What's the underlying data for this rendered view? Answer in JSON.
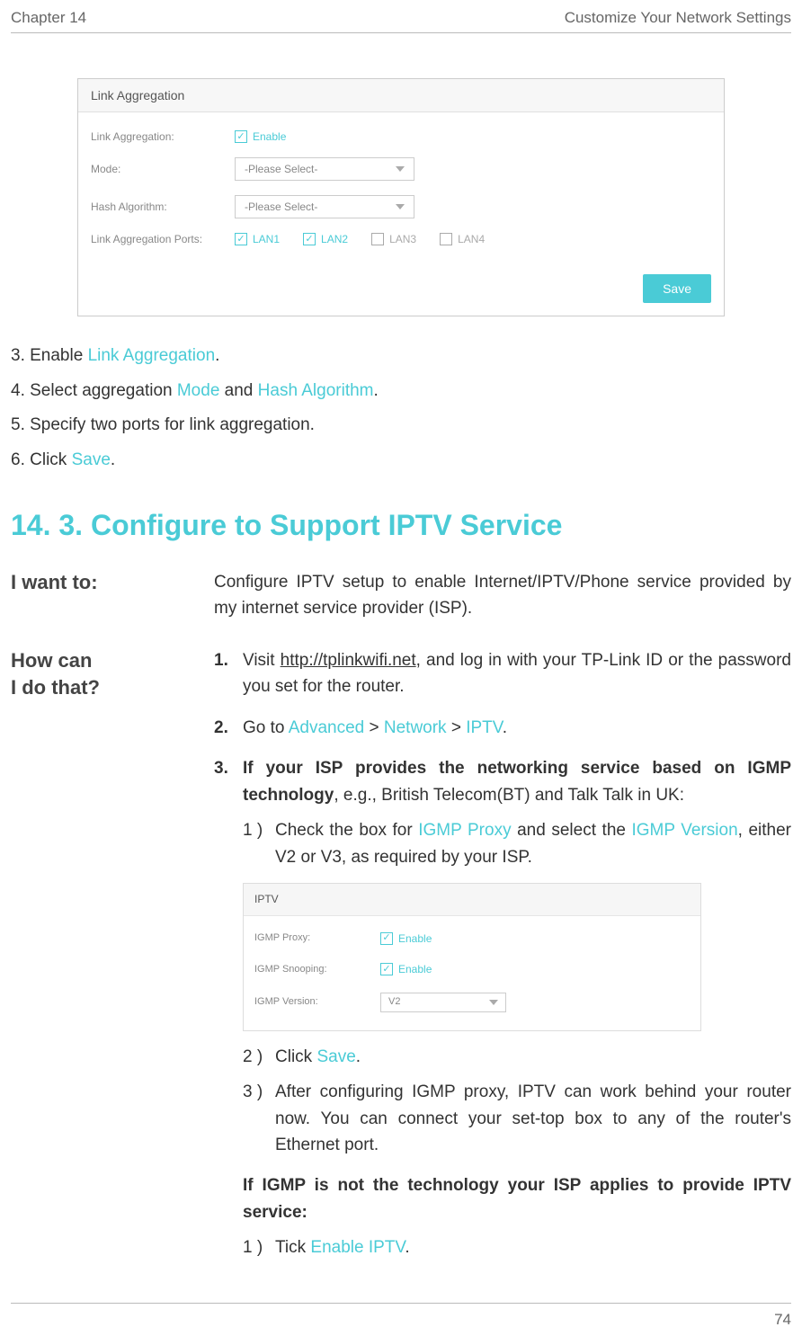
{
  "header": {
    "left": "Chapter 14",
    "right": "Customize Your Network Settings"
  },
  "footer": {
    "page": "74"
  },
  "panel1": {
    "title": "Link Aggregation",
    "rows": {
      "linkAggregationLabel": "Link Aggregation:",
      "enable": "Enable",
      "modeLabel": "Mode:",
      "modeValue": "-Please Select-",
      "hashLabel": "Hash Algorithm:",
      "hashValue": "-Please Select-",
      "portsLabel": "Link Aggregation Ports:",
      "ports": {
        "lan1": "LAN1",
        "lan2": "LAN2",
        "lan3": "LAN3",
        "lan4": "LAN4"
      }
    },
    "save": "Save"
  },
  "steps": {
    "s3a": "3. Enable ",
    "s3b": "Link Aggregation",
    "s3c": ".",
    "s4a": "4. Select aggregation ",
    "s4b": "Mode",
    "s4c": " and ",
    "s4d": "Hash Algorithm",
    "s4e": ".",
    "s5": "5. Specify two ports for link aggregation.",
    "s6a": "6. Click ",
    "s6b": "Save",
    "s6c": "."
  },
  "section": {
    "heading": "14. 3.   Configure to Support IPTV Service"
  },
  "iwant": {
    "label": "I want to:",
    "text": "Configure IPTV setup to enable Internet/IPTV/Phone service provided by my internet service provider (ISP)."
  },
  "howcan": {
    "labelLine1": "How can",
    "labelLine2": "I do that?",
    "li1a": "Visit ",
    "li1url": "http://tplinkwifi.net",
    "li1b": ", and log in with your TP-Link ID or the password you set for the router.",
    "li2a": "Go to ",
    "li2b": "Advanced",
    "li2c": " > ",
    "li2d": "Network",
    "li2e": " > ",
    "li2f": "IPTV",
    "li2g": ".",
    "li3a": "If your ISP provides the networking service based on IGMP technology",
    "li3b": ", e.g., British Telecom(BT) and Talk Talk in UK:",
    "sub1_m": "1 )",
    "sub1a": "Check the box for ",
    "sub1b": "IGMP Proxy",
    "sub1c": " and select the ",
    "sub1d": "IGMP Version",
    "sub1e": ", either V2 or V3, as required by your ISP.",
    "sub2_m": "2 )",
    "sub2a": "Click ",
    "sub2b": "Save",
    "sub2c": ".",
    "sub3_m": "3 )",
    "sub3": "After configuring IGMP proxy, IPTV can work behind your router now. You can connect your set-top box to any of the router's Ethernet port.",
    "alt_intro": "If IGMP is not the technology your ISP applies to provide IPTV service:",
    "alt1_m": "1 )",
    "alt1a": "Tick ",
    "alt1b": "Enable IPTV",
    "alt1c": "."
  },
  "panel2": {
    "title": "IPTV",
    "proxyLabel": "IGMP Proxy:",
    "snoopLabel": "IGMP Snooping:",
    "versionLabel": "IGMP Version:",
    "enable": "Enable",
    "versionValue": "V2"
  }
}
